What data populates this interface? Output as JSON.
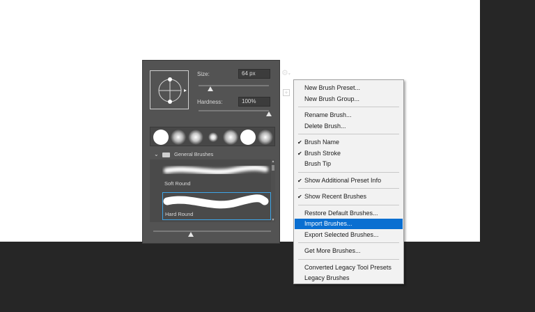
{
  "panel": {
    "size_label": "Size:",
    "size_value": "64 px",
    "size_level": 0.17,
    "hardness_label": "Hardness:",
    "hardness_value": "100%",
    "hardness_level": 1.0,
    "group_name": "General Brushes",
    "brushes": [
      {
        "name": "Soft Round",
        "selected": false
      },
      {
        "name": "Hard Round",
        "selected": true
      }
    ],
    "preview_size_level": 0.32
  },
  "menu": {
    "items": [
      {
        "label": "New Brush Preset...",
        "checked": false,
        "highlighted": false
      },
      {
        "label": "New Brush Group...",
        "checked": false,
        "highlighted": false
      },
      {
        "label": "Rename Brush...",
        "checked": false,
        "highlighted": false
      },
      {
        "label": "Delete Brush...",
        "checked": false,
        "highlighted": false
      },
      {
        "label": "Brush Name",
        "checked": true,
        "highlighted": false
      },
      {
        "label": "Brush Stroke",
        "checked": true,
        "highlighted": false
      },
      {
        "label": "Brush Tip",
        "checked": false,
        "highlighted": false
      },
      {
        "label": "Show Additional Preset Info",
        "checked": true,
        "highlighted": false
      },
      {
        "label": "Show Recent Brushes",
        "checked": true,
        "highlighted": false
      },
      {
        "label": "Restore Default Brushes...",
        "checked": false,
        "highlighted": false
      },
      {
        "label": "Import Brushes...",
        "checked": false,
        "highlighted": true
      },
      {
        "label": "Export Selected Brushes...",
        "checked": false,
        "highlighted": false
      },
      {
        "label": "Get More Brushes...",
        "checked": false,
        "highlighted": false
      },
      {
        "label": "Converted Legacy Tool Presets",
        "checked": false,
        "highlighted": false
      },
      {
        "label": "Legacy Brushes",
        "checked": false,
        "highlighted": false
      }
    ]
  },
  "colors": {
    "highlight": "#0a6fd1",
    "selection_border": "#3ea6e8"
  }
}
